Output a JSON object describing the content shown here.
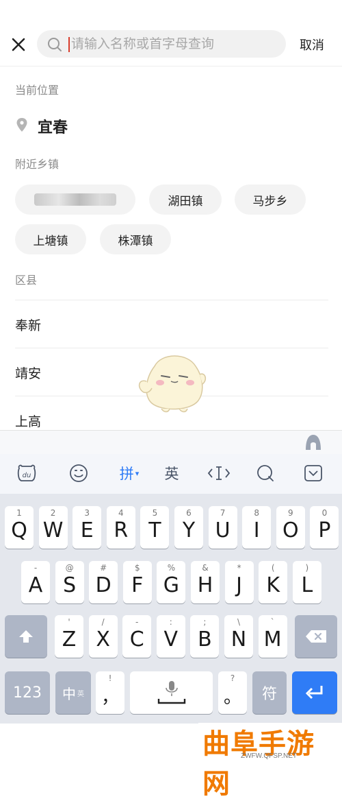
{
  "header": {
    "search_placeholder": "请输入名称或首字母查询",
    "cancel_label": "取消"
  },
  "current_location": {
    "section_label": "当前位置",
    "city": "宜春"
  },
  "nearby_towns": {
    "section_label": "附近乡镇",
    "items": [
      "",
      "湖田镇",
      "马步乡",
      "上塘镇",
      "株潭镇"
    ]
  },
  "counties": {
    "section_label": "区县",
    "items": [
      "奉新",
      "靖安",
      "上高"
    ]
  },
  "ime": {
    "toolbar": {
      "pinyin_label": "拼",
      "english_label": "英"
    },
    "rows": [
      [
        {
          "k": "Q",
          "s": "1"
        },
        {
          "k": "W",
          "s": "2"
        },
        {
          "k": "E",
          "s": "3"
        },
        {
          "k": "R",
          "s": "4"
        },
        {
          "k": "T",
          "s": "5"
        },
        {
          "k": "Y",
          "s": "6"
        },
        {
          "k": "U",
          "s": "7"
        },
        {
          "k": "I",
          "s": "8"
        },
        {
          "k": "O",
          "s": "9"
        },
        {
          "k": "P",
          "s": "0"
        }
      ],
      [
        {
          "k": "A",
          "s": "-"
        },
        {
          "k": "S",
          "s": "@"
        },
        {
          "k": "D",
          "s": "#"
        },
        {
          "k": "F",
          "s": "$"
        },
        {
          "k": "G",
          "s": "%"
        },
        {
          "k": "H",
          "s": "&"
        },
        {
          "k": "J",
          "s": "*"
        },
        {
          "k": "K",
          "s": "("
        },
        {
          "k": "L",
          "s": ")"
        }
      ],
      [
        {
          "k": "Z",
          "s": "'"
        },
        {
          "k": "X",
          "s": "/"
        },
        {
          "k": "C",
          "s": "-"
        },
        {
          "k": "V",
          "s": ":"
        },
        {
          "k": "B",
          "s": ";"
        },
        {
          "k": "N",
          "s": "\\"
        },
        {
          "k": "M",
          "s": "`"
        }
      ]
    ],
    "bottom": {
      "num_label": "123",
      "lang_main": "中",
      "lang_sub": "英",
      "comma_main": "，",
      "comma_sub": "!",
      "period_main": "。",
      "period_sub": "?",
      "symbol_label": "符"
    }
  },
  "watermark": {
    "title": "曲阜手游网",
    "url": "ZWFW.QFSP.NET"
  },
  "colors": {
    "accent_blue": "#2f7cf6",
    "enter_key": "#2f7cf6",
    "gray_key": "#aeb6c6",
    "watermark_orange": "#f07a00"
  }
}
